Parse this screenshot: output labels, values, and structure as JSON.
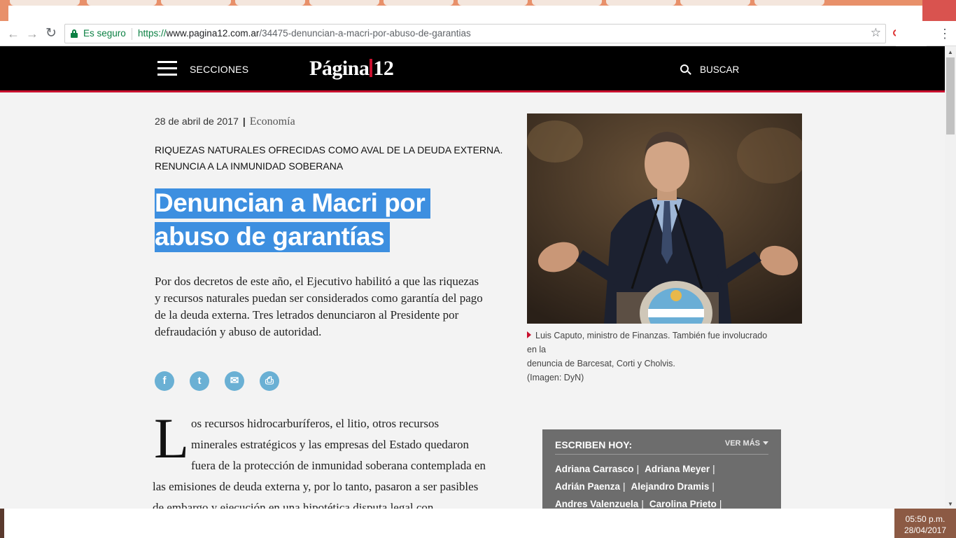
{
  "browser": {
    "secure_label": "Es seguro",
    "url_scheme": "https://",
    "url_host": "www.pagina12.com.ar",
    "url_path": "/34475-denuncian-a-macri-por-abuso-de-garantias"
  },
  "header": {
    "menu_label": "SECCIONES",
    "logo_left": "Página",
    "logo_right": "12",
    "search_label": "BUSCAR"
  },
  "article": {
    "date": "28 de abril de 2017",
    "separator": "|",
    "section": "Economía",
    "volanta_line1": "RIQUEZAS NATURALES OFRECIDAS COMO AVAL DE LA DEUDA EXTERNA.",
    "volanta_line2": "RENUNCIA A LA INMUNIDAD SOBERANA",
    "title": "Denuncian a Macri por abuso de garantías",
    "summary": "Por dos decretos de este año, el Ejecutivo habilitó a que las riquezas y recursos naturales puedan ser considerados como garantía del pago de la deuda externa. Tres letrados denunciaron al Presidente por defraudación y abuso de autoridad.",
    "dropcap": "L",
    "body_line1": "os recursos hidrocarburíferos, el litio, otros recursos",
    "body_line2": "minerales estratégicos y las empresas del Estado quedaron",
    "body_line3": "fuera de la protección de inmunidad soberana contemplada en",
    "body_line4": "las emisiones de deuda externa y, por lo tanto, pasaron a ser pasibles",
    "body_line5": "de embargo y ejecución en una hipotética disputa legal con"
  },
  "share": {
    "facebook": "f",
    "twitter": "t",
    "email": "✉",
    "print": "⎙"
  },
  "photo": {
    "caption_line1": "Luis Caputo, ministro de Finanzas. También fue involucrado en la",
    "caption_line2": "denuncia de Barcesat, Corti y Cholvis.",
    "credit": "(Imagen: DyN)"
  },
  "escriben": {
    "title": "ESCRIBEN HOY:",
    "ver_mas": "VER MÁS",
    "authors": [
      "Adriana Carrasco",
      "Adriana Meyer",
      "Adrián Paenza",
      "Alejandro Dramis",
      "Andres Valenzuela",
      "Carolina Prieto"
    ],
    "pipe": "|"
  },
  "taskbar": {
    "time": "05:50 p.m.",
    "date": "28/04/2017"
  },
  "colors": {
    "brand_red": "#c8102e",
    "highlight_blue": "#3d8fe0",
    "share_blue": "#6ab0d4",
    "secure_green": "#0b8043"
  }
}
